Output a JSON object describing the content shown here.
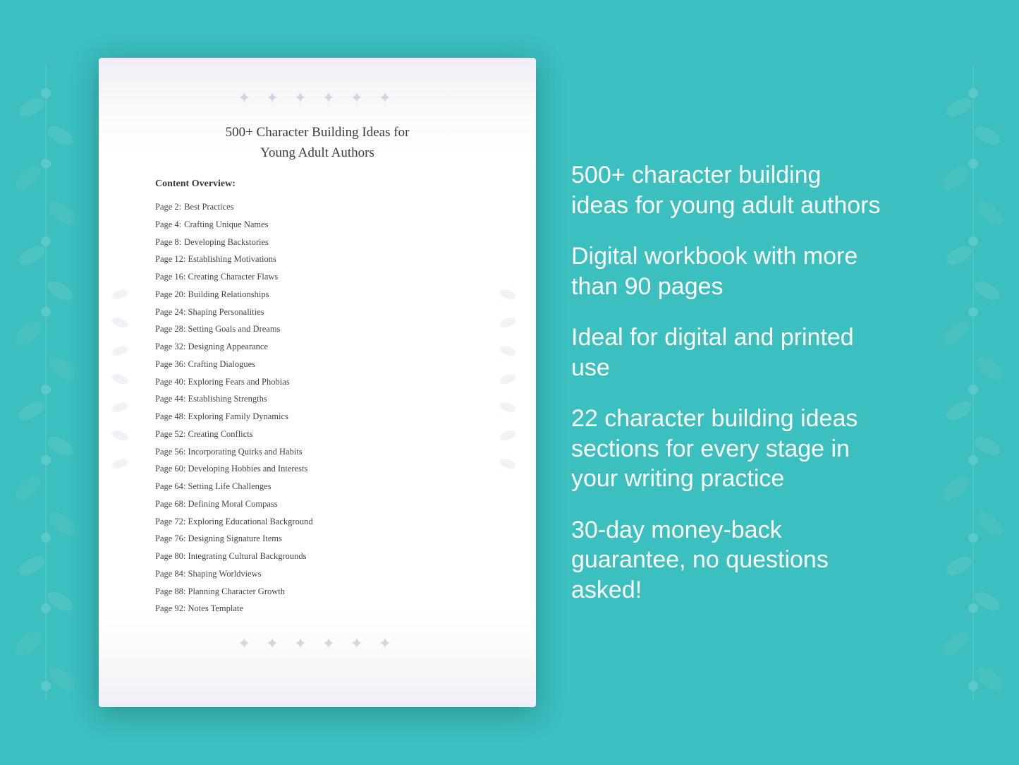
{
  "background": {
    "color": "#3bbfbf"
  },
  "document": {
    "title_line1": "500+ Character Building Ideas for",
    "title_line2": "Young Adult Authors",
    "content_label": "Content Overview:",
    "toc": [
      {
        "page": "Page  2:",
        "title": "Best Practices"
      },
      {
        "page": "Page  4:",
        "title": "Crafting Unique Names"
      },
      {
        "page": "Page  8:",
        "title": "Developing Backstories"
      },
      {
        "page": "Page 12:",
        "title": "Establishing Motivations"
      },
      {
        "page": "Page 16:",
        "title": "Creating Character Flaws"
      },
      {
        "page": "Page 20:",
        "title": "Building Relationships"
      },
      {
        "page": "Page 24:",
        "title": "Shaping Personalities"
      },
      {
        "page": "Page 28:",
        "title": "Setting Goals and Dreams"
      },
      {
        "page": "Page 32:",
        "title": "Designing Appearance"
      },
      {
        "page": "Page 36:",
        "title": "Crafting Dialogues"
      },
      {
        "page": "Page 40:",
        "title": "Exploring Fears and Phobias"
      },
      {
        "page": "Page 44:",
        "title": "Establishing Strengths"
      },
      {
        "page": "Page 48:",
        "title": "Exploring Family Dynamics"
      },
      {
        "page": "Page 52:",
        "title": "Creating Conflicts"
      },
      {
        "page": "Page 56:",
        "title": "Incorporating Quirks and Habits"
      },
      {
        "page": "Page 60:",
        "title": "Developing Hobbies and Interests"
      },
      {
        "page": "Page 64:",
        "title": "Setting Life Challenges"
      },
      {
        "page": "Page 68:",
        "title": "Defining Moral Compass"
      },
      {
        "page": "Page 72:",
        "title": "Exploring Educational Background"
      },
      {
        "page": "Page 76:",
        "title": "Designing Signature Items"
      },
      {
        "page": "Page 80:",
        "title": "Integrating Cultural Backgrounds"
      },
      {
        "page": "Page 84:",
        "title": "Shaping Worldviews"
      },
      {
        "page": "Page 88:",
        "title": "Planning Character Growth"
      },
      {
        "page": "Page 92:",
        "title": "Notes Template"
      }
    ]
  },
  "features": [
    {
      "id": "feature-1",
      "text": "500+ character building ideas for young adult authors"
    },
    {
      "id": "feature-2",
      "text": "Digital workbook with more than 90 pages"
    },
    {
      "id": "feature-3",
      "text": "Ideal for digital and printed use"
    },
    {
      "id": "feature-4",
      "text": "22 character building ideas sections for every stage in your writing practice"
    },
    {
      "id": "feature-5",
      "text": "30-day money-back guarantee, no questions asked!"
    }
  ]
}
